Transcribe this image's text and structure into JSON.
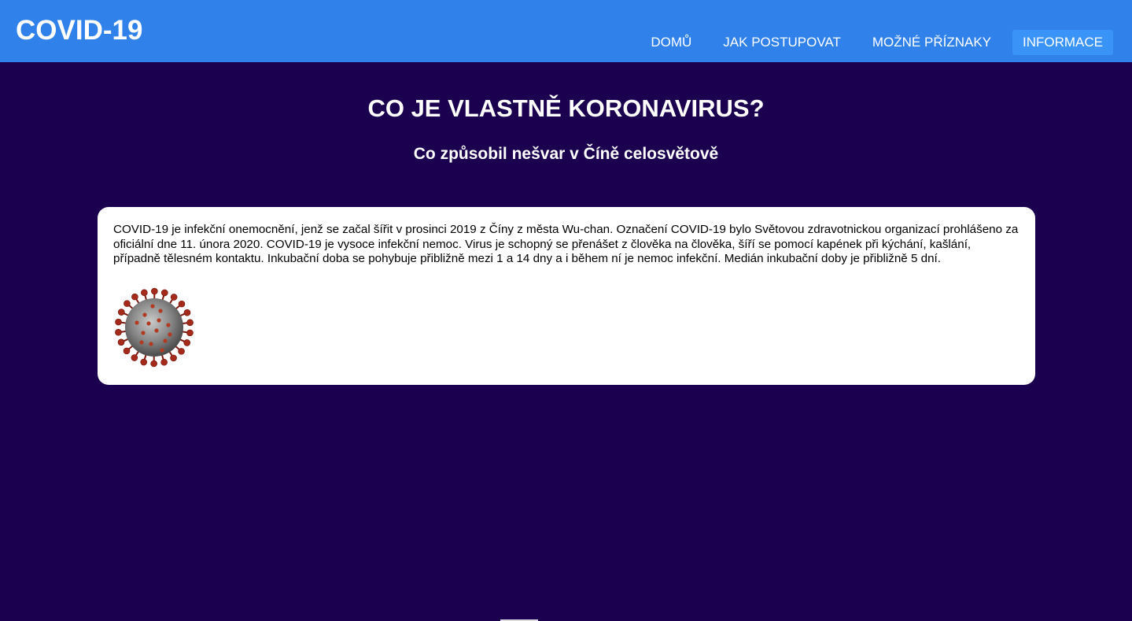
{
  "header": {
    "brand": "COVID-19",
    "nav": [
      {
        "label": "DOMŮ",
        "active": false
      },
      {
        "label": "JAK POSTUPOVAT",
        "active": false
      },
      {
        "label": "MOŽNÉ PŘÍZNAKY",
        "active": false
      },
      {
        "label": "INFORMACE",
        "active": true
      }
    ],
    "accent_color": "#3181ea",
    "active_color": "#3a93f6"
  },
  "main": {
    "title": "CO JE VLASTNĚ KORONAVIRUS?",
    "subtitle": "Co způsobil nešvar v Číně celosvětově",
    "background_color": "#1a004e",
    "card": {
      "text": "COVID-19 je infekční onemocnění, jenž se začal šířit v prosinci 2019 z Číny z města Wu-chan. Označení COVID-19 bylo Světovou zdravotnickou organizací prohlášeno za oficiální dne 11. února 2020. COVID-19 je vysoce infekční nemoc. Virus je schopný se přenášet z člověka na člověka, šíří se pomocí kapének při kýchání, kašlání, případně tělesném kontaktu. Inkubační doba se pohybuje přibližně mezi 1 a 14 dny a i během ní je nemoc infekční. Medián inkubační doby je přibližně 5 dní.",
      "image_icon": "coronavirus-icon"
    }
  }
}
